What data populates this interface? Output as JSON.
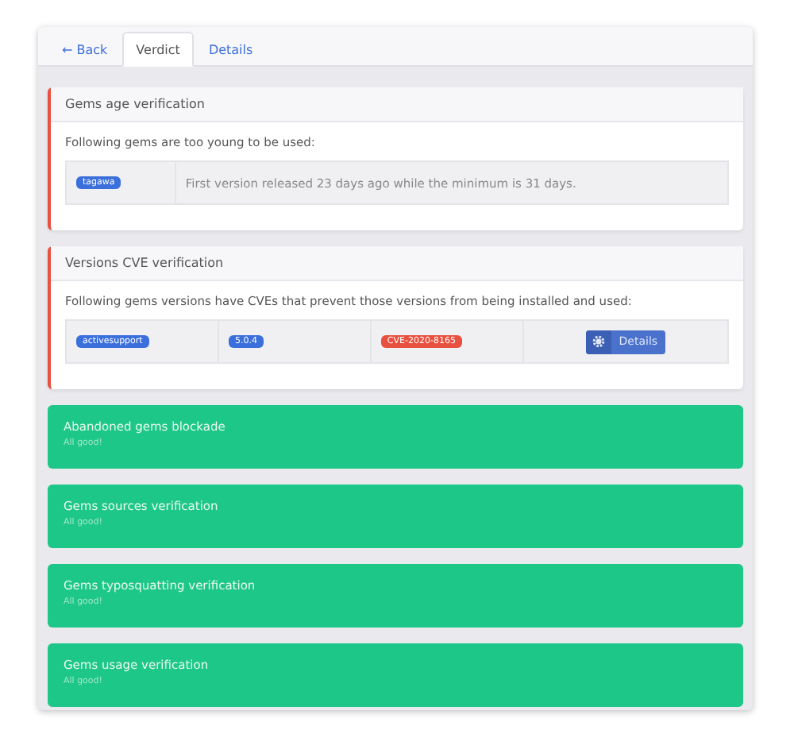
{
  "tabs": [
    {
      "label": "← Back",
      "selected": false
    },
    {
      "label": "Verdict",
      "selected": true
    },
    {
      "label": "Details",
      "selected": false
    }
  ],
  "checks": [
    {
      "kind": "failed",
      "title": "Gems age verification",
      "description": "Following gems are too young to be used:",
      "rows": [
        {
          "cells": [
            {
              "kind": "badge",
              "text": "tagawa",
              "color": "#3b6fdc"
            },
            {
              "kind": "text",
              "text": "First version released 23 days ago while the minimum is 31 days."
            }
          ]
        }
      ]
    },
    {
      "kind": "failed",
      "title": "Versions CVE verification",
      "description": "Following gems versions have CVEs that prevent those versions from being installed and used:",
      "rows": [
        {
          "cells": [
            {
              "kind": "badge",
              "text": "activesupport",
              "color": "#3b6fdc"
            },
            {
              "kind": "badge",
              "text": "5.0.4",
              "color": "#3b6fdc"
            },
            {
              "kind": "badge",
              "text": "CVE-2020-8165",
              "color": "#e8503f"
            },
            {
              "kind": "button",
              "text": "Details"
            }
          ]
        }
      ]
    },
    {
      "kind": "passed",
      "title": "Abandoned gems blockade",
      "description": "All good!"
    },
    {
      "kind": "passed",
      "title": "Gems sources verification",
      "description": "All good!"
    },
    {
      "kind": "passed",
      "title": "Gems typosquatting verification",
      "description": "All good!"
    },
    {
      "kind": "passed",
      "title": "Gems usage verification",
      "description": "All good!"
    }
  ]
}
